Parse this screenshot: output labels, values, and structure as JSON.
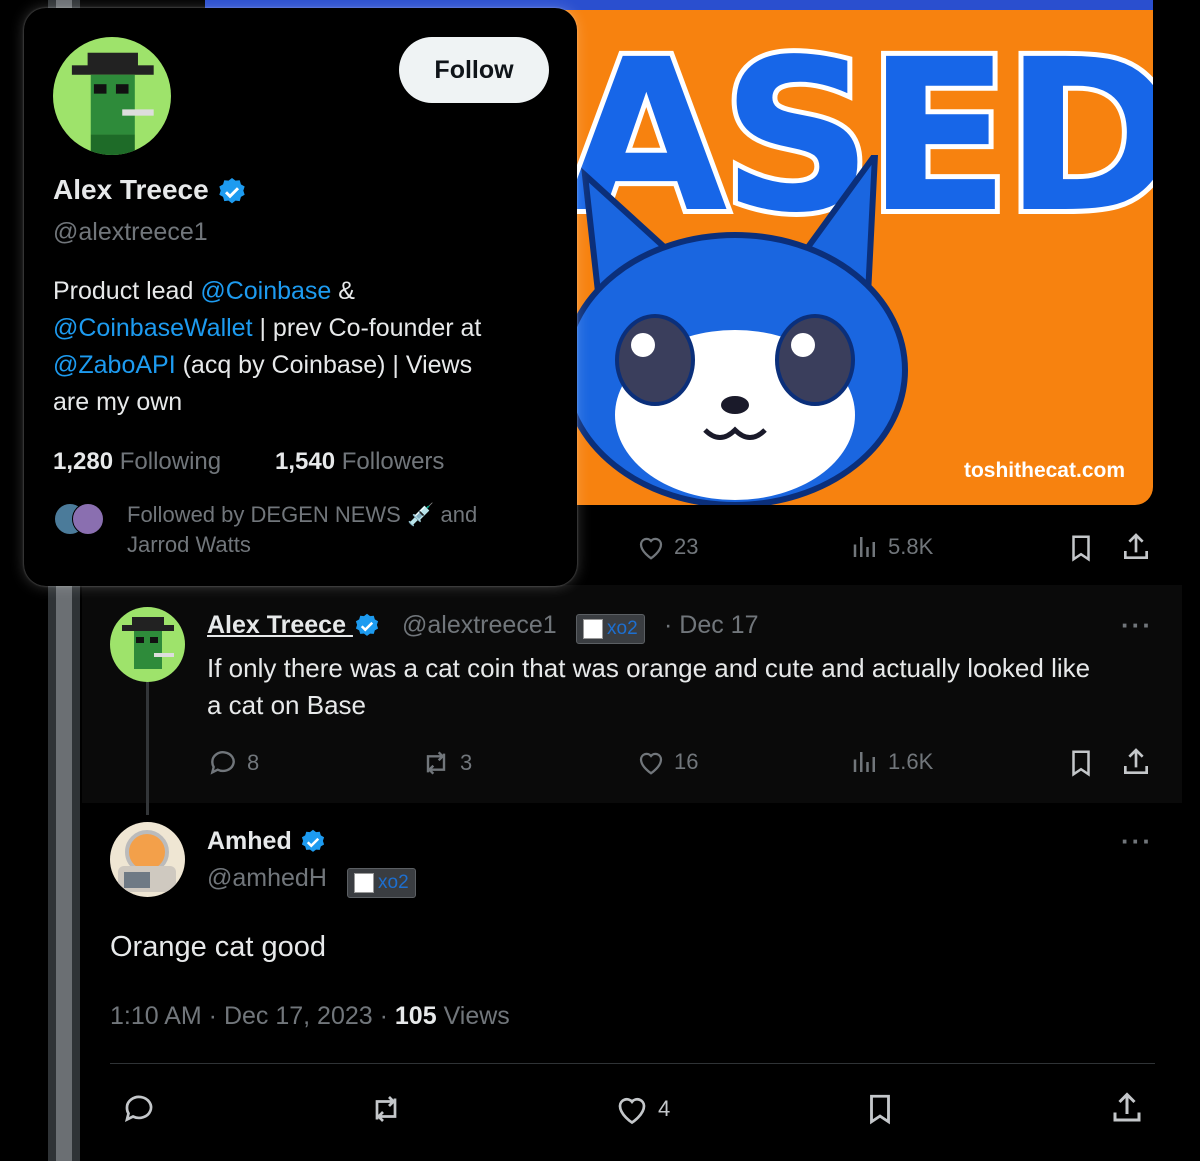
{
  "media": {
    "word": "ASED",
    "credit": "toshithecat.com"
  },
  "top_tweet_actions": {
    "likes": "23",
    "views": "5.8K"
  },
  "hovercard": {
    "follow_label": "Follow",
    "name": "Alex Treece",
    "handle": "@alextreece1",
    "bio": [
      [
        {
          "t": "Product lead ",
          "link": false
        },
        {
          "t": "@Coinbase",
          "link": true
        },
        {
          "t": " &",
          "link": false
        }
      ],
      [
        {
          "t": "@CoinbaseWallet",
          "link": true
        },
        {
          "t": " | prev Co-founder at",
          "link": false
        }
      ],
      [
        {
          "t": "@ZaboAPI",
          "link": true
        },
        {
          "t": " (acq by Coinbase)  | Views",
          "link": false
        }
      ],
      [
        {
          "t": "are my own",
          "link": false
        }
      ]
    ],
    "following_count": "1,280",
    "following_label": "Following",
    "followers_count": "1,540",
    "followers_label": "Followers",
    "followed_by_line1": "Followed by DEGEN NEWS",
    "followed_by_and": "and",
    "followed_by_line2": "Jarrod Watts"
  },
  "reply_tweet": {
    "name": "Alex Treece",
    "handle": "@alextreece1",
    "badge": "xo2",
    "date": "· Dec 17",
    "text_line1": "If only there was a cat coin that was orange and cute and actually looked like",
    "text_line2": "a cat on Base",
    "replies": "8",
    "reposts": "3",
    "likes": "16",
    "views": "1.6K"
  },
  "main_tweet": {
    "name": "Amhed",
    "handle": "@amhedH",
    "badge": "xo2",
    "text": "Orange cat good",
    "time": "1:10 AM · Dec 17, 2023 ·",
    "views_count": "105",
    "views_label": "Views",
    "likes": "4"
  },
  "colors": {
    "accent": "#1d9bf0",
    "background": "#000000",
    "muted": "#71767b",
    "media_bg": "#f7820f"
  }
}
